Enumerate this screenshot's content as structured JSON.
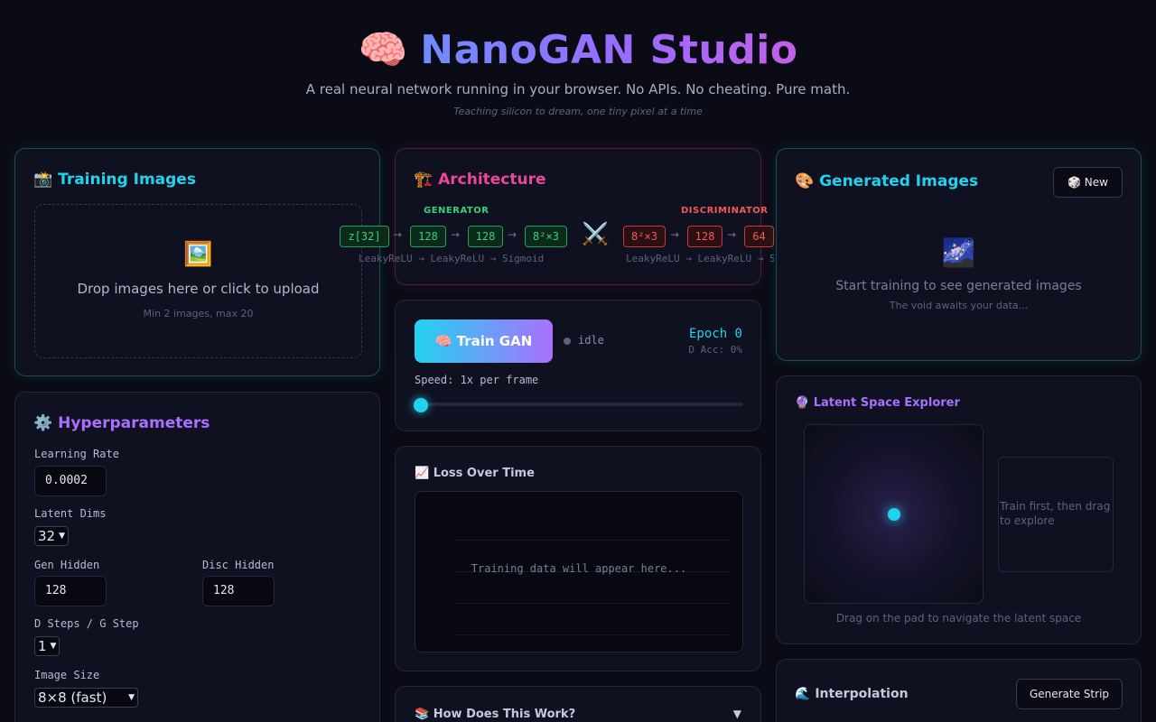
{
  "header": {
    "logo_icon": "brain-icon",
    "logo_glyph": "🧠",
    "title": "NanoGAN Studio",
    "subtitle": "A real neural network running in your browser. No APIs. No cheating. Pure math.",
    "tagline": "Teaching silicon to dream, one tiny pixel at a time"
  },
  "training": {
    "title_icon": "📸",
    "title": "Training Images",
    "drop_icon": "🖼️",
    "drop_text": "Drop images here or click to upload",
    "drop_hint": "Min 2 images, max 20"
  },
  "hyper": {
    "title_icon": "⚙️",
    "title": "Hyperparameters",
    "lr_label": "Learning Rate",
    "lr_value": "0.0002",
    "latent_label": "Latent Dims",
    "latent_value": "32",
    "gen_hidden_label": "Gen Hidden",
    "gen_hidden_value": "128",
    "disc_hidden_label": "Disc Hidden",
    "disc_hidden_value": "128",
    "dsteps_label": "D Steps / G Step",
    "dsteps_value": "1",
    "imgsize_label": "Image Size",
    "imgsize_value": "8×8 (fast)"
  },
  "arch": {
    "title_icon": "🏗️",
    "title": "Architecture",
    "gen_label": "GENERATOR",
    "disc_label": "DISCRIMINATOR",
    "gen_nodes": [
      "z[32]",
      "128",
      "128",
      "8²×3"
    ],
    "disc_nodes": [
      "8²×3",
      "128",
      "64"
    ],
    "arrow": "→",
    "versus_glyph": "⚔️",
    "gen_activations": "LeakyReLU → LeakyReLU → Sigmoid",
    "disc_activations": "LeakyReLU → LeakyReLU → Sigmoid"
  },
  "train": {
    "button_label": "🧠 Train GAN",
    "status": "idle",
    "epoch": "Epoch 0",
    "d_acc": "D Acc: 0%",
    "speed_label": "Speed: 1x per frame"
  },
  "loss": {
    "title_icon": "📈",
    "title": "Loss Over Time",
    "empty_text": "Training data will appear here..."
  },
  "how": {
    "title_icon": "📚",
    "title": "How Does This Work?",
    "chevron": "▼"
  },
  "generated": {
    "title_icon": "🎨",
    "title": "Generated Images",
    "new_button": "🎲 New",
    "empty_icon": "🌌",
    "empty_text": "Start training to see generated images",
    "empty_sub": "The void awaits your data..."
  },
  "latent": {
    "title_icon": "🔮",
    "title": "Latent Space Explorer",
    "output_text": "Train first, then drag to explore",
    "hint": "Drag on the pad to navigate the latent space"
  },
  "interp": {
    "title_icon": "🌊",
    "title": "Interpolation",
    "button": "Generate Strip"
  },
  "colors": {
    "background": "#0a0b14",
    "cyan": "#22d3ee",
    "purple": "#a970ff",
    "pink": "#ec4899",
    "green": "#34d27b",
    "red": "#f05a5a"
  }
}
